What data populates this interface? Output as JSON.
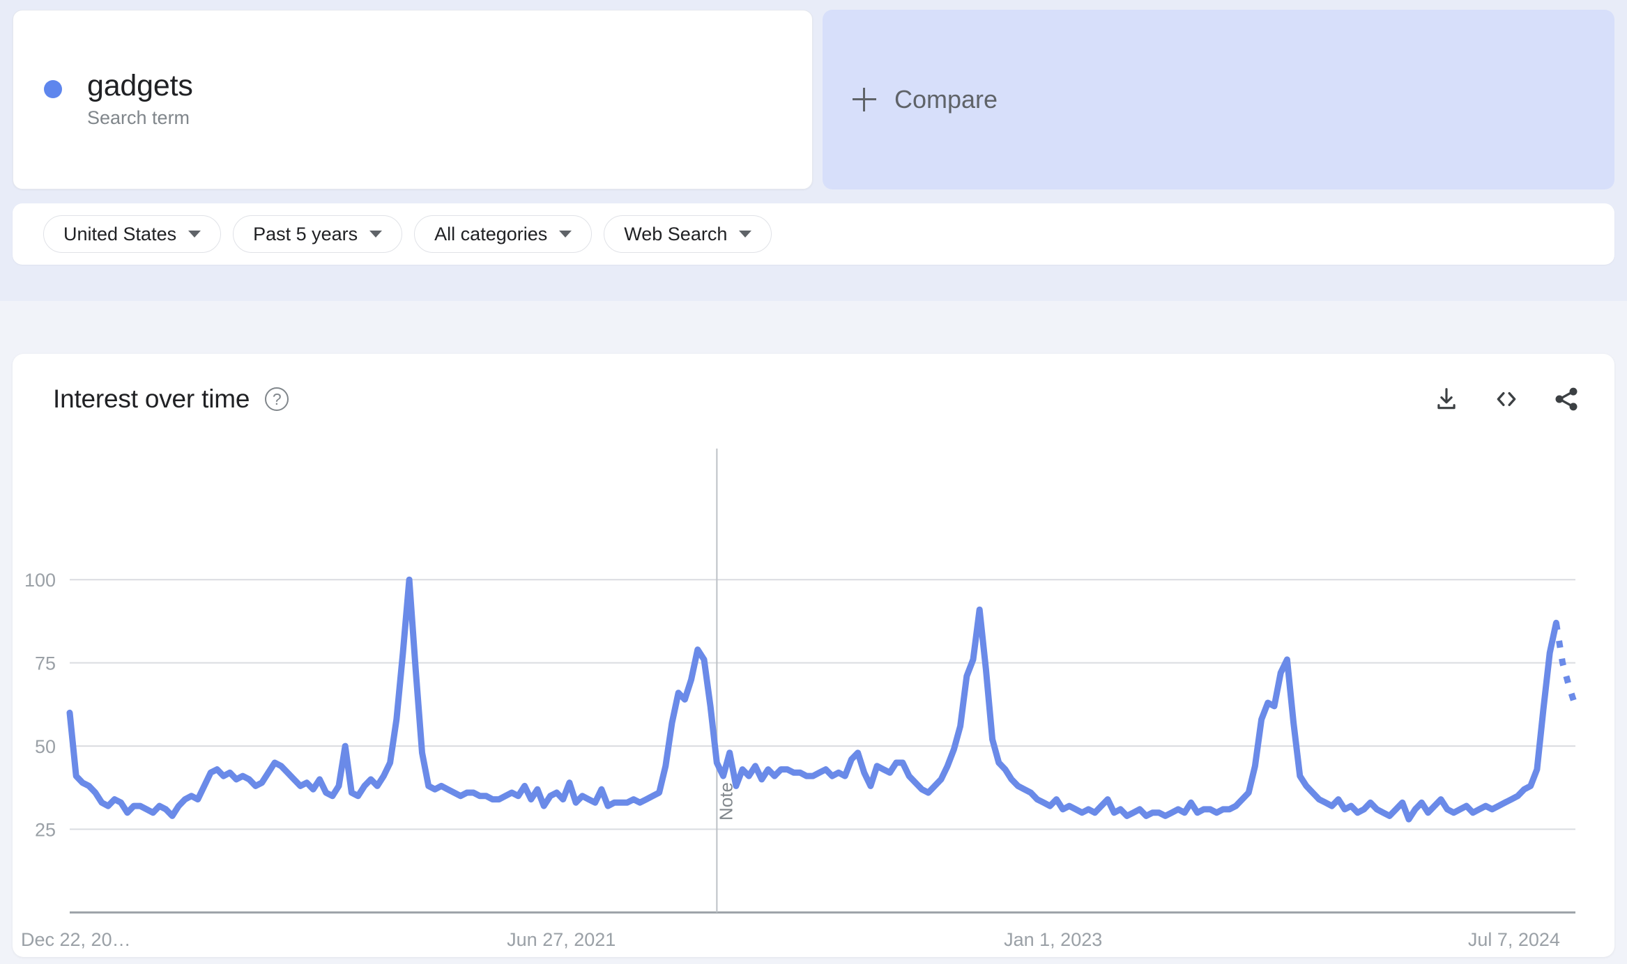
{
  "colors": {
    "accent": "#5e86ed",
    "line": "#6a8ae8",
    "page_bg_top": "#e8ecf8",
    "page_bg": "#f1f3f9",
    "card_bg": "#ffffff",
    "compare_bg": "#d7dffa",
    "grid": "#dadce0",
    "axis_text": "#9aa0a6",
    "note_text": "#80868b"
  },
  "query": {
    "term": "gadgets",
    "type_label": "Search term",
    "dot_icon": "series-color-dot"
  },
  "compare": {
    "label": "Compare",
    "plus_icon": "plus-icon"
  },
  "filters": [
    {
      "label": "United States",
      "name": "location-filter"
    },
    {
      "label": "Past 5 years",
      "name": "time-range-filter"
    },
    {
      "label": "All categories",
      "name": "category-filter"
    },
    {
      "label": "Web Search",
      "name": "search-type-filter"
    }
  ],
  "chart_panel": {
    "title": "Interest over time",
    "help_icon": "help-circle-icon",
    "help_glyph": "?",
    "actions": [
      {
        "name": "download-csv-button",
        "icon": "download-icon"
      },
      {
        "name": "embed-code-button",
        "icon": "code-embed-icon"
      },
      {
        "name": "share-button",
        "icon": "share-icon"
      }
    ]
  },
  "chart_data": {
    "type": "line",
    "title": "Interest over time",
    "xlabel": "",
    "ylabel": "",
    "ylim": [
      0,
      108
    ],
    "yticks": [
      25,
      50,
      75,
      100
    ],
    "ytick_labels": [
      "25",
      "50",
      "75",
      "100"
    ],
    "grid": true,
    "legend": "none",
    "xtick_labels": [
      "Dec 22, 20…",
      "Jun 27, 2021",
      "Jan 1, 2023",
      "Jul 7, 2024"
    ],
    "xtick_positions": [
      0,
      0.3265,
      0.6531,
      0.9592
    ],
    "annotation": {
      "label": "Note",
      "x_fraction": 0.4298,
      "rotated": true
    },
    "partial_data_dashed_tail": true,
    "series": [
      {
        "name": "gadgets",
        "color": "#6a8ae8",
        "values": [
          60,
          41,
          39,
          38,
          36,
          33,
          32,
          34,
          33,
          30,
          32,
          32,
          31,
          30,
          32,
          31,
          29,
          32,
          34,
          35,
          34,
          38,
          42,
          43,
          41,
          42,
          40,
          41,
          40,
          38,
          39,
          42,
          45,
          44,
          42,
          40,
          38,
          39,
          37,
          40,
          36,
          35,
          38,
          50,
          36,
          35,
          38,
          40,
          38,
          41,
          45,
          58,
          78,
          100,
          73,
          48,
          38,
          37,
          38,
          37,
          36,
          35,
          36,
          36,
          35,
          35,
          34,
          34,
          35,
          36,
          35,
          38,
          34,
          37,
          32,
          35,
          36,
          34,
          39,
          33,
          35,
          34,
          33,
          37,
          32,
          33,
          33,
          33,
          34,
          33,
          34,
          35,
          36,
          44,
          57,
          66,
          64,
          70,
          79,
          76,
          62,
          45,
          41,
          48,
          38,
          43,
          41,
          44,
          40,
          43,
          41,
          43,
          43,
          42,
          42,
          41,
          41,
          42,
          43,
          41,
          42,
          41,
          46,
          48,
          42,
          38,
          44,
          43,
          42,
          45,
          45,
          41,
          39,
          37,
          36,
          38,
          40,
          44,
          49,
          56,
          71,
          76,
          91,
          73,
          52,
          45,
          43,
          40,
          38,
          37,
          36,
          34,
          33,
          32,
          34,
          31,
          32,
          31,
          30,
          31,
          30,
          32,
          34,
          30,
          31,
          29,
          30,
          31,
          29,
          30,
          30,
          29,
          30,
          31,
          30,
          33,
          30,
          31,
          31,
          30,
          31,
          31,
          32,
          34,
          36,
          44,
          58,
          63,
          62,
          72,
          76,
          57,
          41,
          38,
          36,
          34,
          33,
          32,
          34,
          31,
          32,
          30,
          31,
          33,
          31,
          30,
          29,
          31,
          33,
          28,
          31,
          33,
          30,
          32,
          34,
          31,
          30,
          31,
          32,
          30,
          31,
          32,
          31,
          32,
          33,
          34,
          35,
          37,
          38,
          43,
          61,
          78,
          87,
          75,
          68,
          62
        ]
      }
    ]
  }
}
